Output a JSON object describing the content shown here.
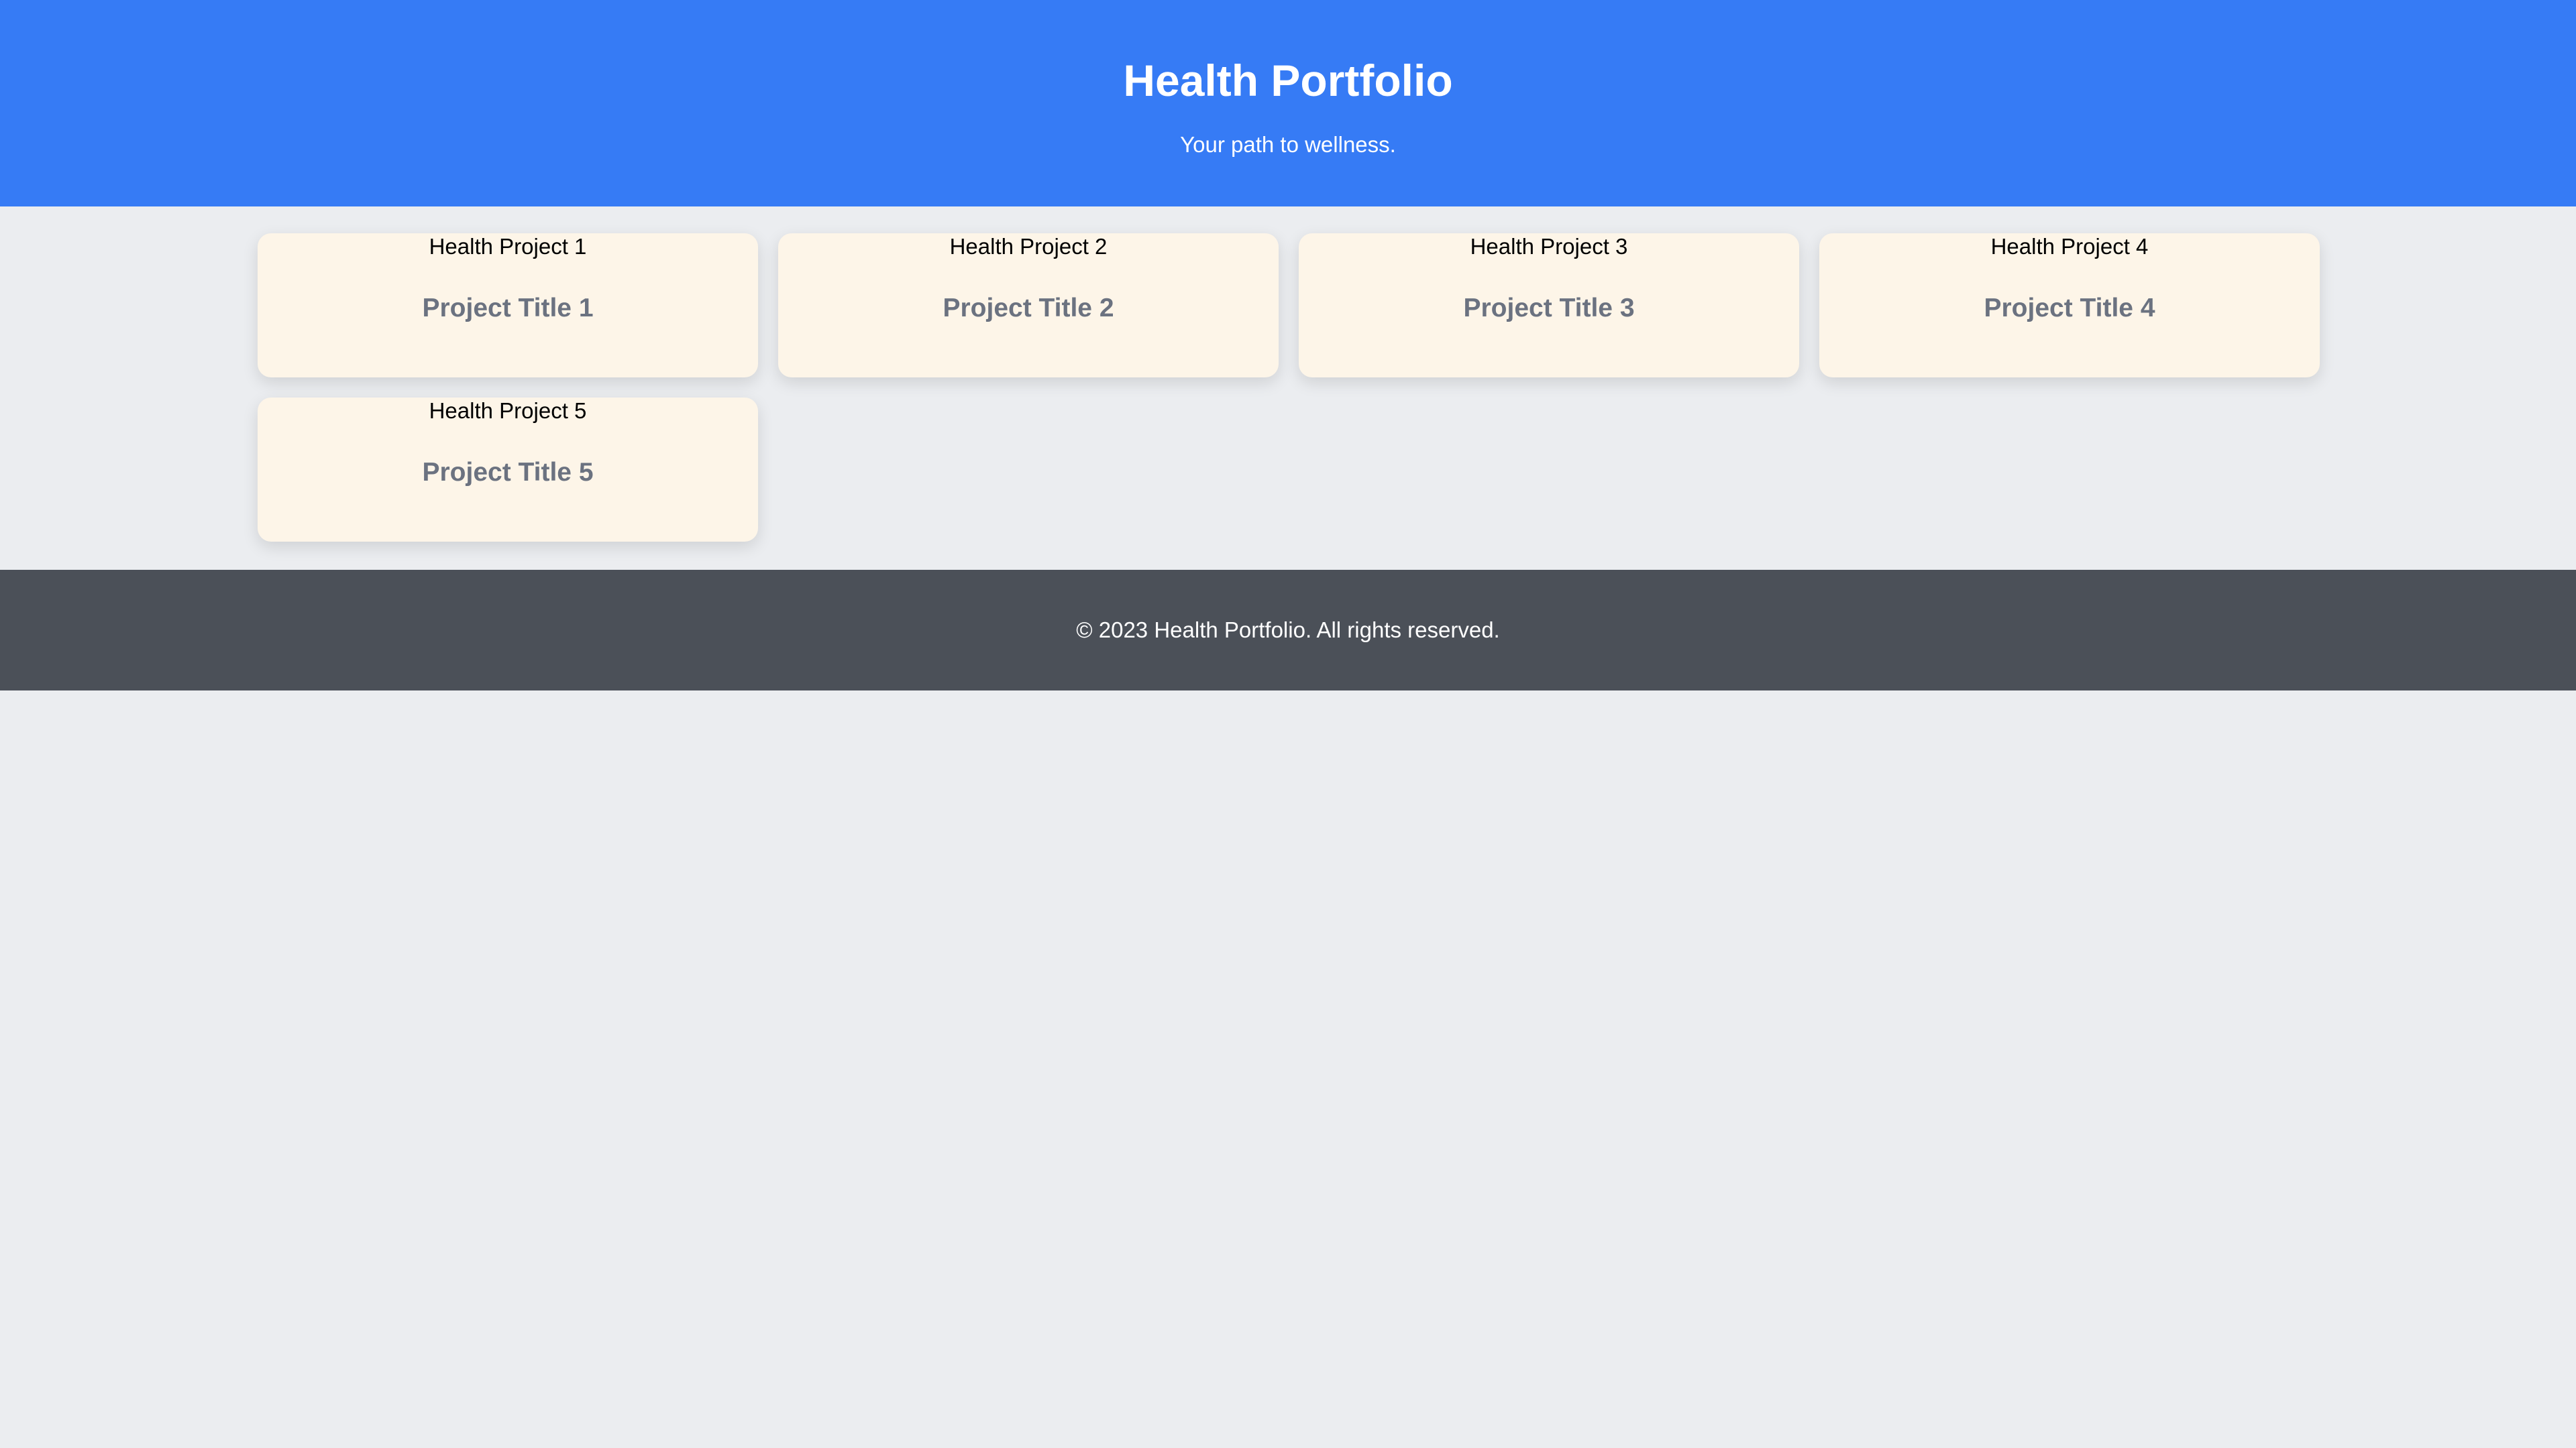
{
  "header": {
    "title": "Health Portfolio",
    "tagline": "Your path to wellness."
  },
  "projects": [
    {
      "image_alt": "Health Project 1",
      "title": "Project Title 1"
    },
    {
      "image_alt": "Health Project 2",
      "title": "Project Title 2"
    },
    {
      "image_alt": "Health Project 3",
      "title": "Project Title 3"
    },
    {
      "image_alt": "Health Project 4",
      "title": "Project Title 4"
    },
    {
      "image_alt": "Health Project 5",
      "title": "Project Title 5"
    }
  ],
  "footer": {
    "copyright": "© 2023 Health Portfolio. All rights reserved."
  },
  "colors": {
    "header_bg": "#367bf5",
    "page_bg": "#ebedf0",
    "card_bg": "#fdf5e8",
    "card_title": "#6b7280",
    "footer_bg": "#4b5058"
  }
}
